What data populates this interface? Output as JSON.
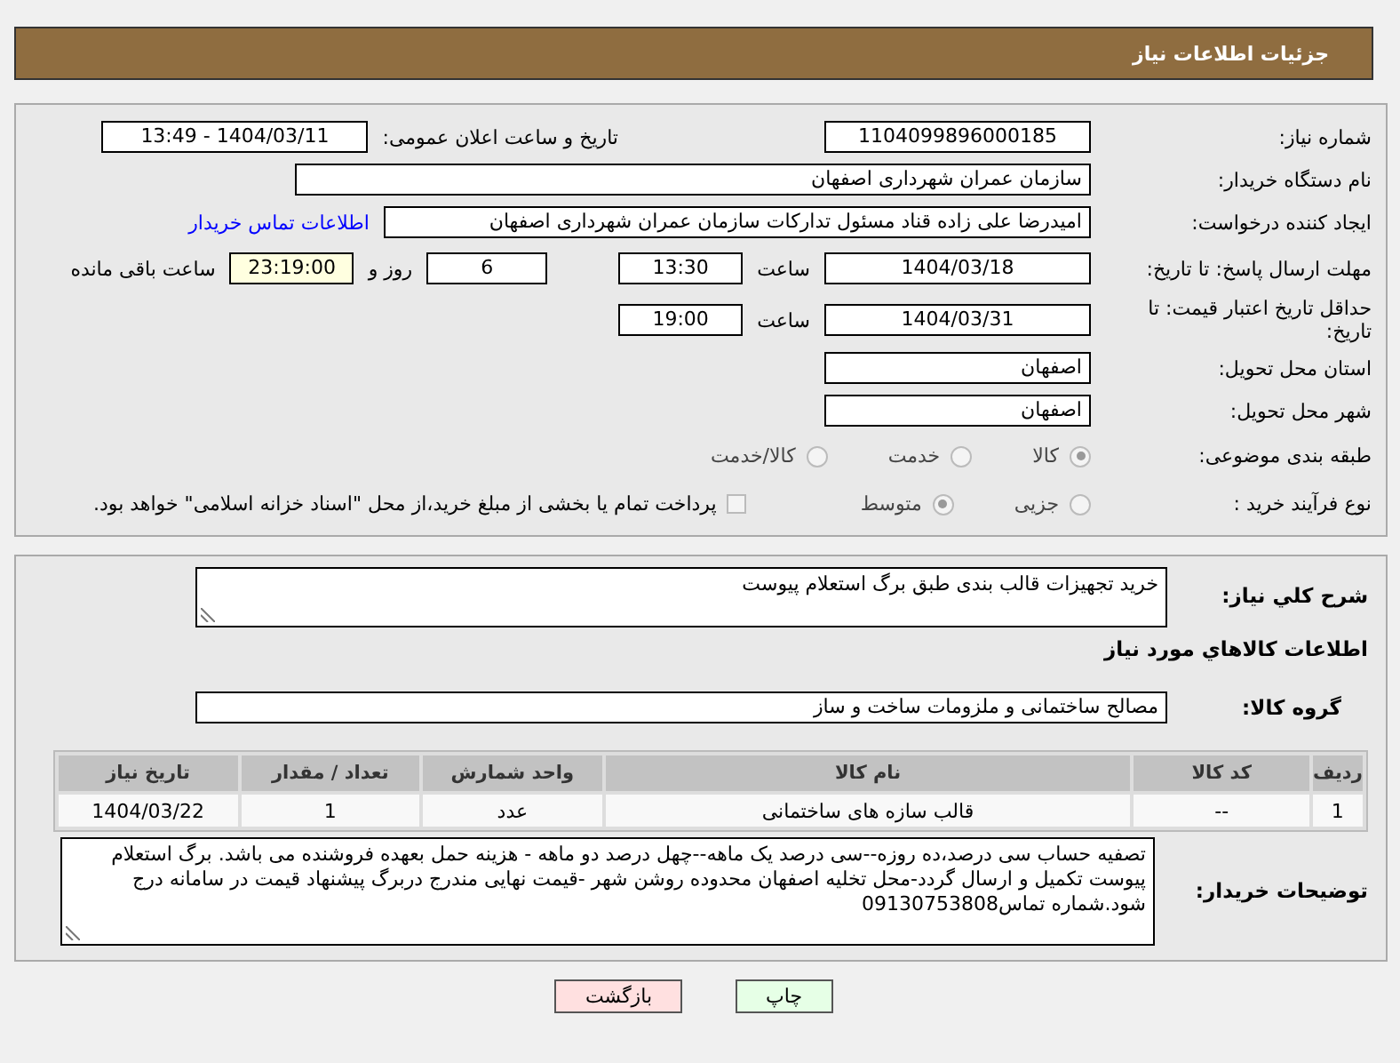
{
  "header": {
    "title": "جزئیات اطلاعات نیاز"
  },
  "need_number": {
    "label": "شماره نیاز:",
    "value": "1104099896000185"
  },
  "announce": {
    "label": "تاریخ و ساعت اعلان عمومی:",
    "value": "1404/03/11 - 13:49"
  },
  "buyer_org": {
    "label": "نام دستگاه خریدار:",
    "value": "سازمان عمران شهرداری اصفهان"
  },
  "requester": {
    "label": "ایجاد کننده درخواست:",
    "value": "امیدرضا علی زاده قناد مسئول تدارکات سازمان عمران شهرداری اصفهان",
    "link": "اطلاعات تماس خریدار"
  },
  "reply_deadline": {
    "label": "مهلت ارسال پاسخ: تا تاریخ:",
    "date": "1404/03/18",
    "time_label": "ساعت",
    "time": "13:30",
    "days": "6",
    "days_label": "روز و",
    "remaining": "23:19:00",
    "remaining_label": "ساعت باقی مانده"
  },
  "price_validity": {
    "label": "حداقل تاریخ اعتبار قیمت: تا تاریخ:",
    "date": "1404/03/31",
    "time_label": "ساعت",
    "time": "19:00"
  },
  "province": {
    "label": "استان محل تحویل:",
    "value": "اصفهان"
  },
  "city": {
    "label": "شهر محل تحویل:",
    "value": "اصفهان"
  },
  "category": {
    "label": "طبقه بندی موضوعی:",
    "options": [
      {
        "label": "کالا",
        "selected": true
      },
      {
        "label": "خدمت",
        "selected": false
      },
      {
        "label": "کالا/خدمت",
        "selected": false
      }
    ]
  },
  "purchase_process": {
    "label": "نوع فرآیند خرید :",
    "options": [
      {
        "label": "جزیی",
        "selected": false
      },
      {
        "label": "متوسط",
        "selected": true
      }
    ],
    "payment": {
      "label": "پرداخت تمام یا بخشی از مبلغ خرید،از محل \"اسناد خزانه اسلامی\" خواهد بود.",
      "checked": false
    }
  },
  "description": {
    "label": "شرح کلي نیاز:",
    "value": "خرید تجهیزات قالب بندی طبق برگ استعلام پیوست"
  },
  "items_section": {
    "title": "اطلاعات كالاهاي مورد نياز"
  },
  "goods_group": {
    "label": "گروه کالا:",
    "value": "مصالح ساختمانی و ملزومات ساخت و ساز"
  },
  "table": {
    "columns": [
      "ردیف",
      "کد کالا",
      "نام کالا",
      "واحد شمارش",
      "تعداد / مقدار",
      "تاریخ نیاز"
    ],
    "rows": [
      [
        "1",
        "--",
        "قالب سازه های ساختمانی",
        "عدد",
        "1",
        "1404/03/22"
      ]
    ]
  },
  "buyer_notes": {
    "label": "توضیحات خریدار:",
    "value": "تصفیه حساب سی درصد،ده روزه--سی درصد یک ماهه--چهل درصد دو ماهه - هزینه حمل بعهده فروشنده می باشد. برگ استعلام پیوست تکمیل و ارسال گردد-محل تخلیه اصفهان محدوده روشن شهر -قیمت نهایی مندرج دربرگ پیشنهاد قیمت در سامانه درج شود.شماره تماس09130753808"
  },
  "buttons": [
    {
      "label": "چاپ",
      "kind": "print"
    },
    {
      "label": "بازگشت",
      "kind": "back"
    }
  ]
}
